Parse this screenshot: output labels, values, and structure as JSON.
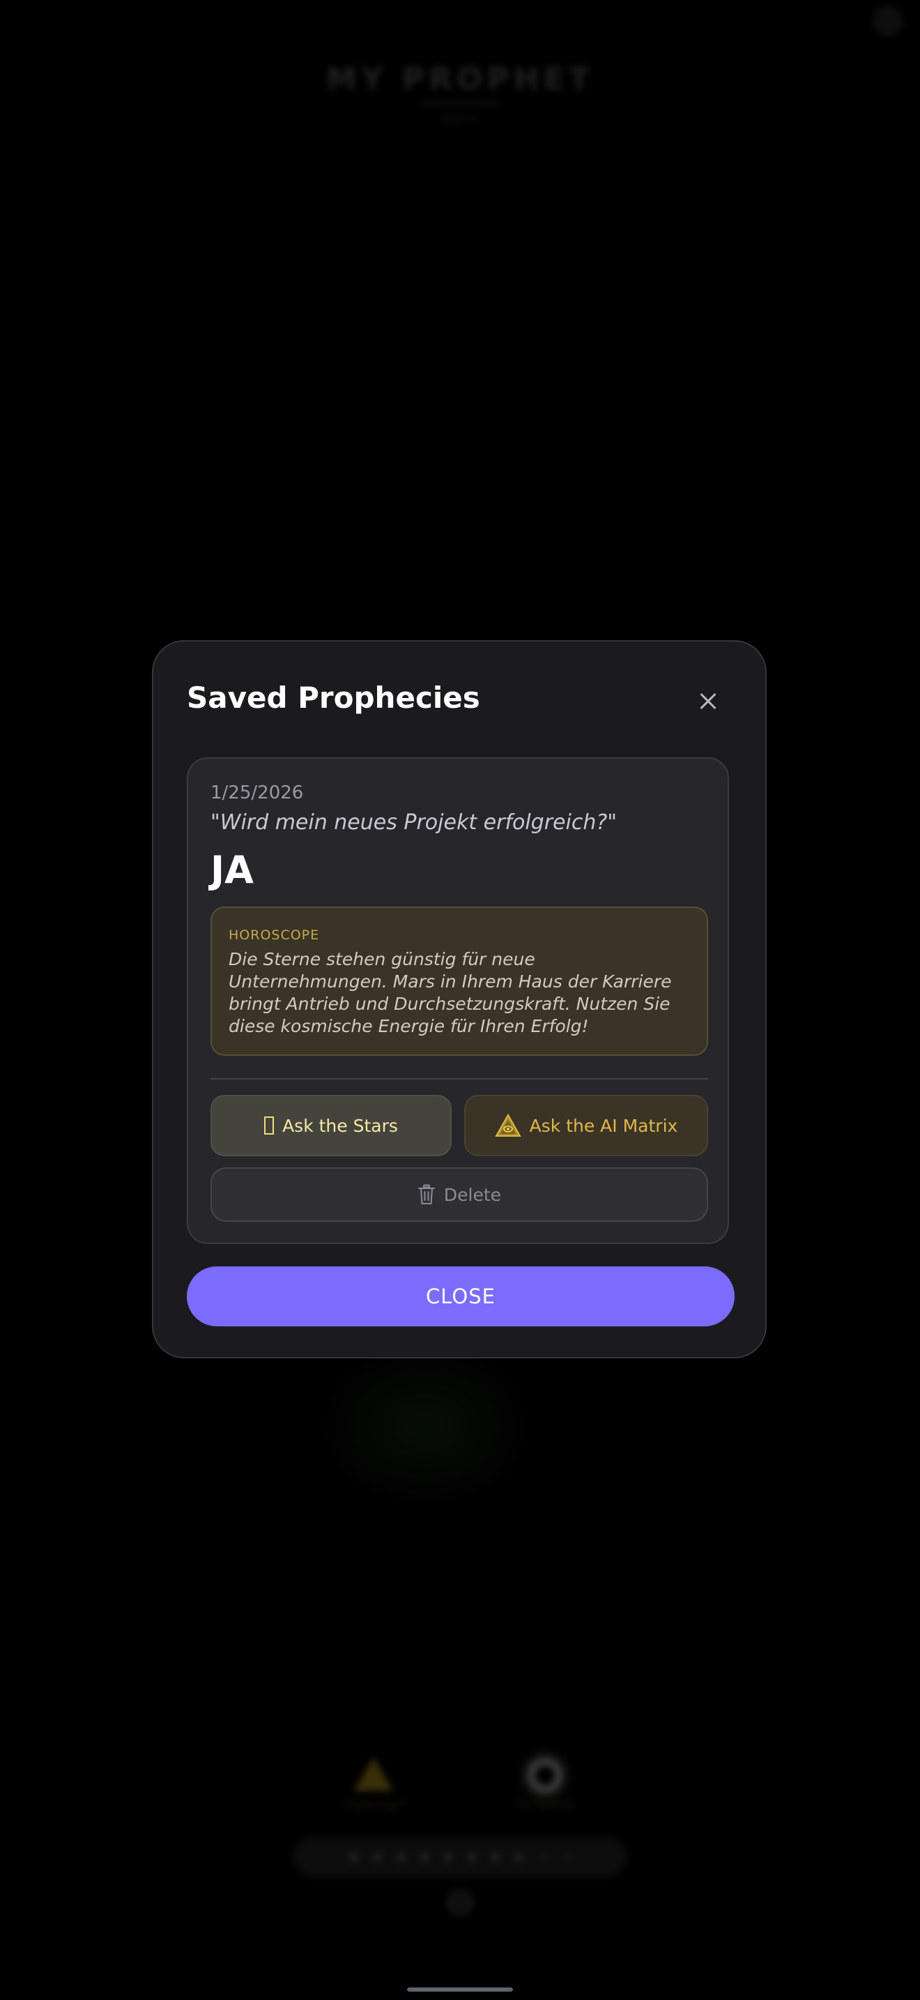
{
  "background": {
    "app_title": "MY PROPHET",
    "app_subtitle": "Sierra",
    "feature_left_label": "Challenge?",
    "feature_right_label": "No Speed",
    "page_dots": 10
  },
  "modal": {
    "title": "Saved Prophecies",
    "close_icon": "close-icon",
    "close_button_label": "CLOSE"
  },
  "prophecy": {
    "date": "1/25/2026",
    "question": "\"Wird mein neues Projekt erfolgreich?\"",
    "answer": "JA",
    "horoscope_label": "HOROSCOPE",
    "horoscope_text": "Die Sterne stehen günstig für neue Unternehmungen. Mars in Ihrem Haus der Karriere bringt Antrieb und Durchsetzungskraft. Nutzen Sie diese kosmische Energie für Ihren Erfolg!",
    "actions": {
      "ask_stars_label": "Ask the Stars",
      "ask_stars_icon": "stars-placeholder-icon",
      "ask_matrix_label": "Ask the AI Matrix",
      "ask_matrix_icon": "eye-triangle-icon",
      "delete_label": "Delete",
      "delete_icon": "trash-icon"
    }
  },
  "colors": {
    "accent": "#7b6cfd",
    "gold": "#e1b84a",
    "modal_bg": "#1b1b1f",
    "card_bg": "#26262b"
  }
}
